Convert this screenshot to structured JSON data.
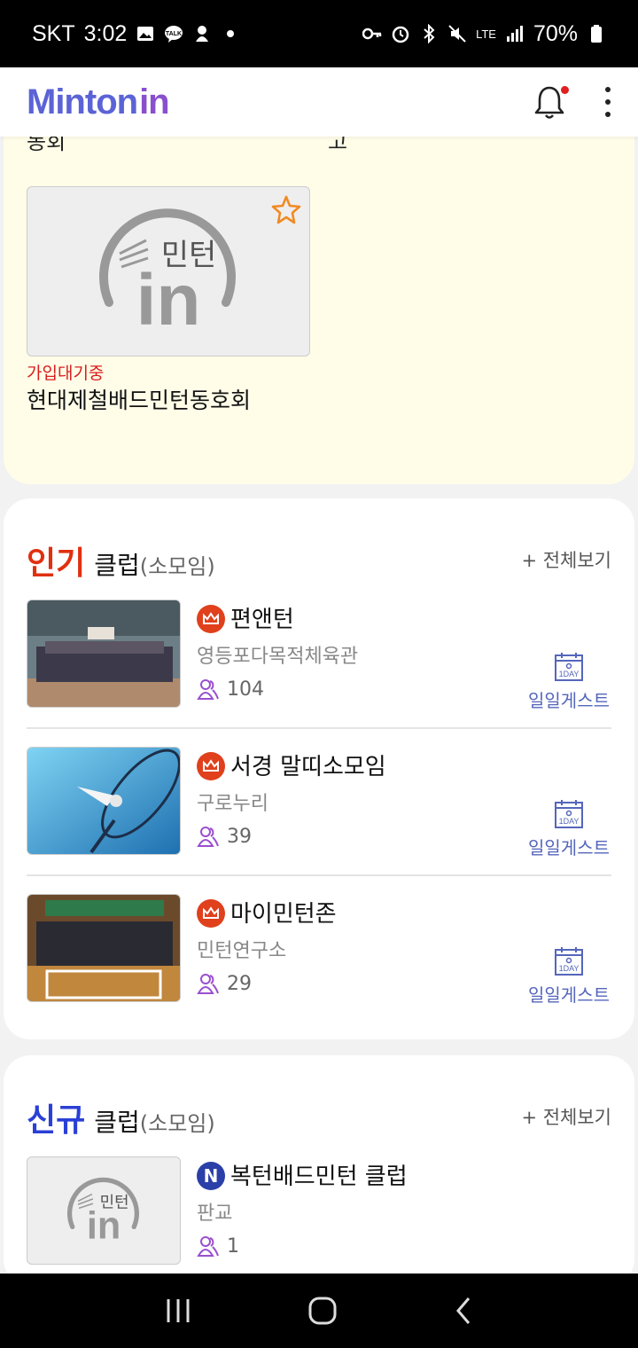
{
  "status_bar": {
    "carrier": "SKT",
    "time": "3:02",
    "battery": "70%",
    "network": "LTE"
  },
  "app_bar": {
    "logo_main": "Minton",
    "logo_in": "in",
    "bell_icon": "bell-icon",
    "menu_icon": "kebab-menu-icon",
    "has_notification": true
  },
  "my_clubs": {
    "cutoff_left": "동회",
    "cutoff_right": "고",
    "items": [
      {
        "status": "가입대기중",
        "name": "현대제철배드민턴동호회",
        "placeholder_text": "민턴",
        "starred": false
      }
    ]
  },
  "popular": {
    "accent": "인기",
    "title": "클럽",
    "sub": "(소모임)",
    "see_all": "+ 전체보기",
    "accent_color": "#e03010",
    "clubs": [
      {
        "name": "편앤턴",
        "place": "영등포다목적체육관",
        "members": "104",
        "guest": "일일게스트",
        "badge": "crown"
      },
      {
        "name": "서경 말띠소모임",
        "place": "구로누리",
        "members": "39",
        "guest": "일일게스트",
        "badge": "crown"
      },
      {
        "name": "마이민턴존",
        "place": "민턴연구소",
        "members": "29",
        "guest": "일일게스트",
        "badge": "crown"
      }
    ]
  },
  "newclubs": {
    "accent": "신규",
    "title": "클럽",
    "sub": "(소모임)",
    "see_all": "+ 전체보기",
    "accent_color": "#2a3fd6",
    "clubs": [
      {
        "name": "복턴배드민턴 클럽",
        "place": "판교",
        "members": "1",
        "badge": "N",
        "placeholder_text": "민턴"
      }
    ]
  },
  "guest_icon_text": "1DAY"
}
